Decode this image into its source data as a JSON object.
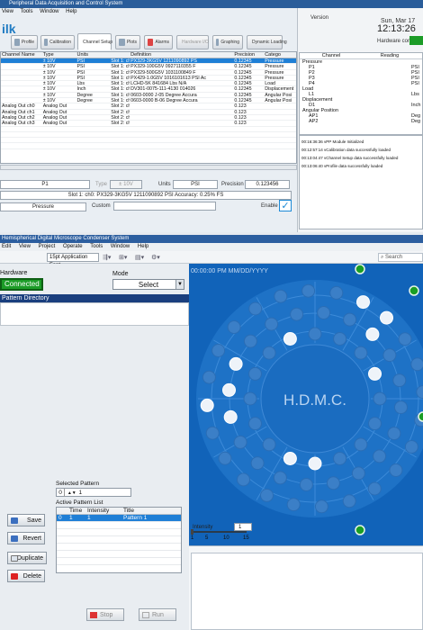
{
  "top_window": {
    "title": "Peripheral Data Acquisition and Control System",
    "menu": [
      "View",
      "Tools",
      "Window",
      "Help"
    ],
    "logo": "ilk",
    "toolbar": [
      {
        "label": "Profile"
      },
      {
        "label": "Calibration"
      },
      {
        "label": "Channel Setup",
        "active": true
      },
      {
        "label": "Plots"
      },
      {
        "label": "Alarms"
      },
      {
        "label": "Hardware I/O"
      },
      {
        "label": "Graphing"
      },
      {
        "label": "Dynamic Loading"
      }
    ],
    "grid": {
      "headers": [
        "Channel Name",
        "Type",
        "Units",
        "",
        "Definition",
        "",
        "Precision",
        "Catego"
      ],
      "rows": [
        [
          "",
          "± 10V",
          "PSI",
          "Slot 1: ch0",
          "PX329-3KG5V 1211090892 PS",
          "",
          "0.12345",
          "Pressure"
        ],
        [
          "",
          "± 10V",
          "PSI",
          "Slot 1: ch1",
          "PX329-100G5V 0927110355 F",
          "",
          "0.12345",
          "Pressure"
        ],
        [
          "",
          "± 10V",
          "PSI",
          "Slot 1: ch2",
          "PX329-500G5V 1031100849 F",
          "",
          "0.12345",
          "Pressure"
        ],
        [
          "",
          "± 10V",
          "PSI",
          "Slot 1: ch3",
          "PX429-1.0G5V 1016101613 PSI Ac",
          "",
          "0.12345",
          "Pressure"
        ],
        [
          "",
          "± 10V",
          "Lbs",
          "Slot 1: ch4",
          "LCHD-5K 841684 Lbs N/A",
          "",
          "0.12345",
          "Load"
        ],
        [
          "",
          "± 10V",
          "Inch",
          "Slot 1: ch5",
          "DV301-0075-111-4130 014026",
          "",
          "0.12345",
          "Displacement"
        ],
        [
          "",
          "± 10V",
          "Degree",
          "Slot 1: ch6",
          "0603-0000 J-05 Degree Accura",
          "",
          "0.12345",
          "Angular Posi"
        ],
        [
          "",
          "± 10V",
          "Degree",
          "Slot 1: ch7",
          "0603-0000 B-06 Degree Accura",
          "",
          "0.12345",
          "Angular Posi"
        ],
        [
          "Analog Out ch0",
          "Analog Out",
          "",
          "Slot 2: ch0",
          "",
          "",
          "0.123",
          ""
        ],
        [
          "Analog Out ch1",
          "Analog Out",
          "",
          "Slot 2: ch1",
          "",
          "",
          "0.123",
          ""
        ],
        [
          "Analog Out ch2",
          "Analog Out",
          "",
          "Slot 2: ch2",
          "",
          "",
          "0.123",
          ""
        ],
        [
          "Analog Out ch3",
          "Analog Out",
          "",
          "Slot 2: ch3",
          "",
          "",
          "0.123",
          ""
        ]
      ]
    },
    "detail": {
      "name": "P1",
      "type_label": "Type",
      "type": "± 10V",
      "units_label": "Units",
      "units": "PSI",
      "precision_label": "Precision",
      "precision": "0.123456",
      "definition": "Slot 1: ch0: PX329-3KG5V 1211090892 PSI Accuracy: 0.25% FS",
      "category": "Pressure",
      "custom_label": "Custom",
      "custom_value": "",
      "enable_label": "Enable"
    },
    "right": {
      "version_label": "Version",
      "date": "Sun, Mar 17",
      "time": "12:13:26",
      "hw_label": "Hardware conn",
      "tree_headers": [
        "Channel",
        "Reading"
      ],
      "tree": [
        "Pressure",
        "P1",
        "P2",
        "P3",
        "P4",
        "Load",
        "L1",
        "Displacement",
        "D1",
        "Angular Position",
        "AP1",
        "AP2"
      ],
      "readings": [
        "PSI",
        "PSI",
        "PSI",
        "PSI",
        "Lbs",
        "Inch",
        "Deg",
        "Deg"
      ],
      "log": [
        "00:16:36:36 vPP Module Initialized",
        "00:12:57:14 vCalibration data successfully loaded",
        "00:13:04:47 vChannel Setup data successfully loaded",
        "00:13:06:40 vProfile data successfully loaded"
      ]
    }
  },
  "bottom_window": {
    "title": "Hemispherical Digital Microscope Condenser System",
    "menu": [
      "Edit",
      "View",
      "Project",
      "Operate",
      "Tools",
      "Window",
      "Help"
    ],
    "font_select": "15pt Application Font",
    "search_placeholder": "Search",
    "hardware_label": "Hardware",
    "connected": "Connected",
    "mode_label": "Mode",
    "mode_value": "Select",
    "directory_label": "Pattern Directory",
    "selected_pattern_label": "Selected Pattern",
    "selected_pattern_index": "0",
    "selected_pattern_value": "1",
    "active_list_label": "Active Pattern List",
    "active_list_headers": [
      "",
      "Time",
      "Intensity",
      "Title"
    ],
    "active_list_rows": [
      [
        "0",
        "1",
        "1",
        "Pattern 1"
      ]
    ],
    "buttons": {
      "save": "Save",
      "revert": "Revert",
      "duplicate": "Duplicate",
      "delete": "Delete",
      "stop": "Stop",
      "run": "Run"
    },
    "scope_time": "00:00:00 PM  MM/DD/YYYY",
    "hdmc_logo": "H.D.M.C.",
    "intensity_label": "Intensity",
    "intensity_value": "1",
    "intensity_ticks": [
      "1",
      "5",
      "10",
      "15"
    ],
    "colors": {
      "title_bar": "#2c5e9f",
      "connected": "#1c9c27",
      "scope_bg": "#1163b9",
      "selection": "#1f7fd6"
    }
  }
}
